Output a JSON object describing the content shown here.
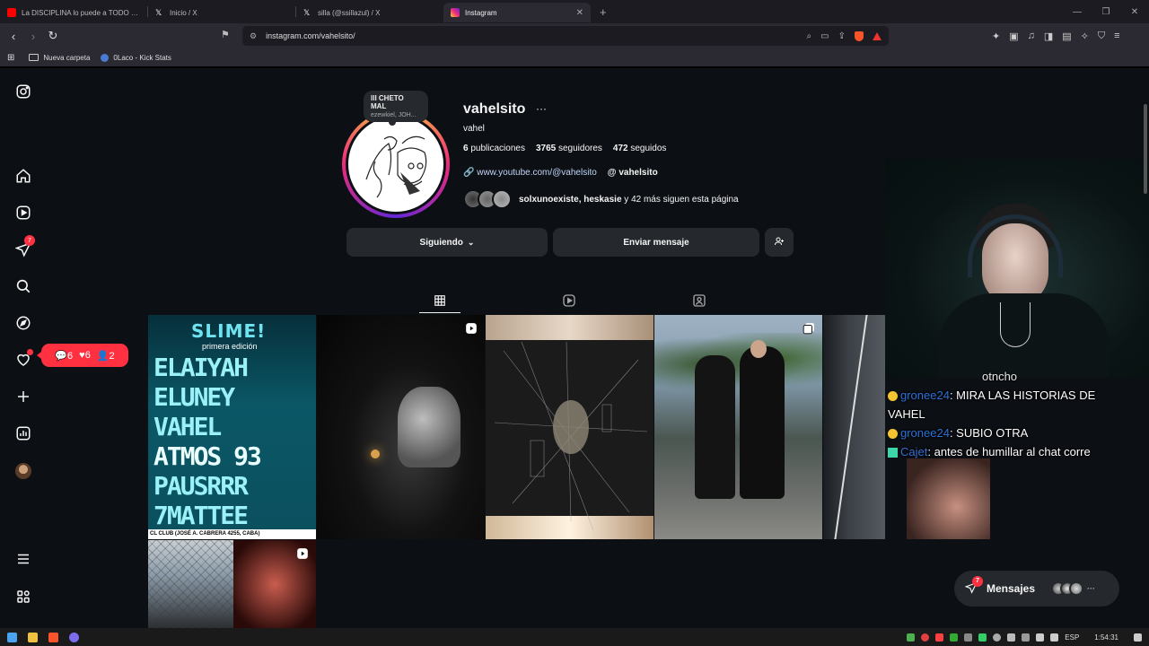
{
  "browser": {
    "tabs": [
      {
        "title": "La DISCIPLINA lo puede a TODO - El...",
        "favicon_color": "#ff0000",
        "active": false
      },
      {
        "title": "Inicio / X",
        "favicon_color": "#ffffff",
        "active": false
      },
      {
        "title": "silla (@ssillazul) / X",
        "favicon_color": "#ffffff",
        "active": false
      },
      {
        "title": "Instagram",
        "favicon_color": "#e1306c",
        "active": true
      }
    ],
    "new_tab_label": "+",
    "url": "instagram.com/vahelsito/",
    "bookmarks": [
      {
        "label": "Nueva carpeta",
        "icon": "folder-icon"
      },
      {
        "label": "0Laco - Kick Stats",
        "icon": "kick-icon"
      }
    ]
  },
  "sidebar": {
    "notifications_badge": "7",
    "activity_pill": {
      "comments": "6",
      "likes": "6",
      "follows": "2"
    }
  },
  "profile": {
    "note_title": "llI CHETO MAL",
    "note_sub": "ezewkiel, JOH...",
    "username": "vahelsito",
    "more_label": "···",
    "full_name": "vahel",
    "stats": {
      "posts_count": "6",
      "posts_label": "publicaciones",
      "followers_count": "3765",
      "followers_label": "seguidores",
      "following_count": "472",
      "following_label": "seguidos"
    },
    "link": "www.youtube.com/@vahelsito",
    "threads": "vahelsito",
    "followed_by_bold": "solxunoexiste, heskasie",
    "followed_by_rest": " y 42 más siguen esta página",
    "buttons": {
      "following": "Siguiendo",
      "message": "Enviar mensaje"
    }
  },
  "posts": {
    "flyer": {
      "title": "SLIME!",
      "subtitle": "primera edición",
      "lineup": [
        "ELAIYAH",
        "ELUNEY",
        "VAHEL",
        "ATMOS 93",
        "PAUSRRR",
        "7MATTEE"
      ],
      "footer": "CL CLUB (JOSÉ A. CABRERA 4255, CABA)"
    }
  },
  "stream": {
    "chat": [
      {
        "user": "",
        "text": "otncho"
      },
      {
        "user": "gronee24",
        "text": ": MIRA LAS HISTORIAS DE"
      },
      {
        "user": "",
        "text": "VAHEL"
      },
      {
        "user": "gronee24",
        "text": ": SUBIO OTRA"
      },
      {
        "user": "Cajet",
        "text": ": antes de humillar al chat corre"
      }
    ]
  },
  "messages_pill": {
    "label": "Mensajes",
    "badge": "7"
  },
  "taskbar": {
    "lang": "ESP",
    "time": "1:54:31"
  }
}
